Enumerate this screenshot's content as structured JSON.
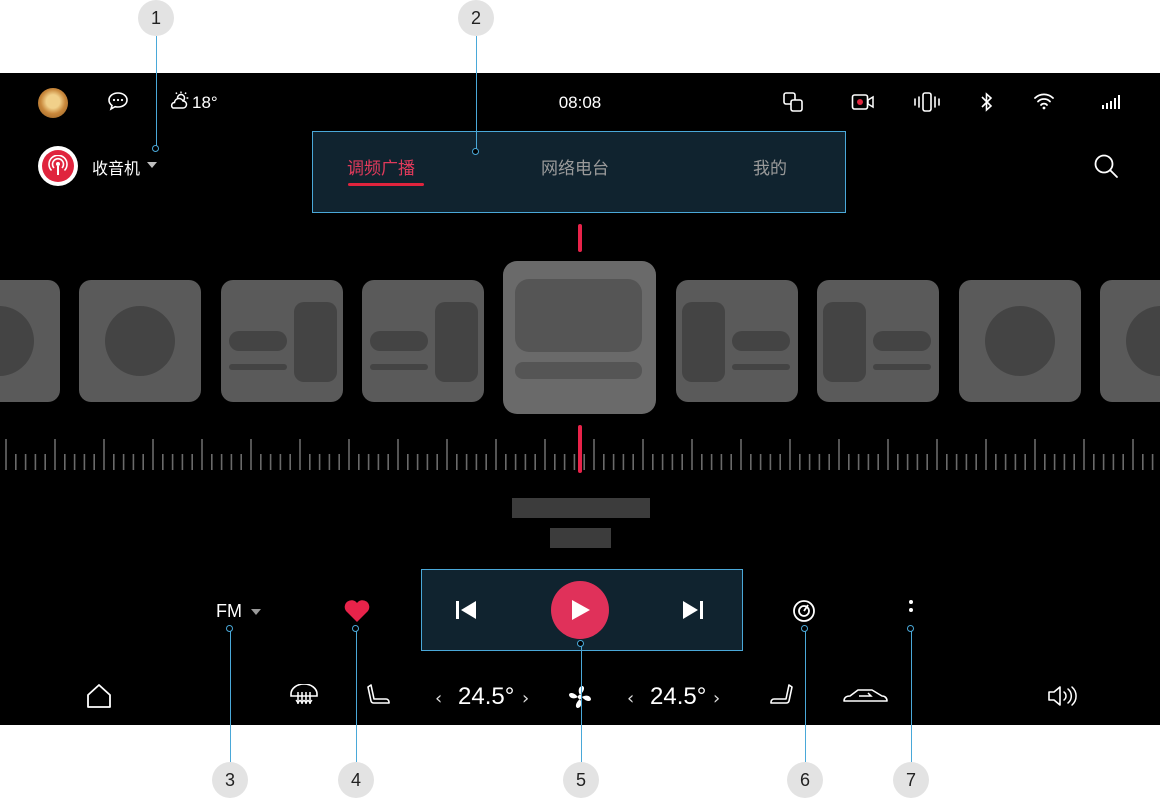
{
  "annotations": [
    "1",
    "2",
    "3",
    "4",
    "5",
    "6",
    "7"
  ],
  "status_bar": {
    "temperature": "18°",
    "time": "08:08",
    "icons": [
      "avatar",
      "message-icon",
      "weather-icon",
      "screen-cast-icon",
      "record-icon",
      "vibrate-icon",
      "bluetooth-icon",
      "wifi-icon",
      "signal-icon"
    ]
  },
  "header": {
    "app_title": "收音机",
    "tabs": [
      {
        "label": "调频广播",
        "active": true
      },
      {
        "label": "网络电台",
        "active": false
      },
      {
        "label": "我的",
        "active": false
      }
    ]
  },
  "player": {
    "band": "FM",
    "favorite": true,
    "controls": [
      "previous",
      "play",
      "next"
    ]
  },
  "climate": {
    "left_temp": "24.5°",
    "right_temp": "24.5°"
  },
  "colors": {
    "accent": "#e0243d",
    "play": "#e0315a",
    "highlight_border": "#4aa8d8",
    "highlight_fill": "#10232f"
  }
}
